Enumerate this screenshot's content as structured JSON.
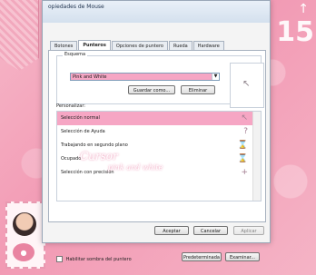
{
  "window": {
    "title": "opiedades de Mouse",
    "tabs": [
      {
        "label": "Botones"
      },
      {
        "label": "Punteros"
      },
      {
        "label": "Opciones de puntero"
      },
      {
        "label": "Rueda"
      },
      {
        "label": "Hardware"
      }
    ]
  },
  "scheme": {
    "group_label": "Esquema",
    "selected": "Pink and White",
    "save_as_label": "Guardar como...",
    "delete_label": "Eliminar"
  },
  "personalize": {
    "label": "Personalizar:",
    "items": [
      {
        "name": "Selección normal",
        "icon": "arrow-cursor"
      },
      {
        "name": "Selección de Ayuda",
        "icon": "help-cursor"
      },
      {
        "name": "Trabajando en segundo plano",
        "icon": "busy-cursor"
      },
      {
        "name": "Ocupado",
        "icon": "hourglass-cursor"
      },
      {
        "name": "Selección con precisión",
        "icon": "crosshair-cursor"
      }
    ]
  },
  "overlay": {
    "title": "Cursor",
    "subtitle": "pink and white"
  },
  "options": {
    "shadow_label": "Habilitar sombra del puntero",
    "default_label": "Predeterminada",
    "browse_label": "Examinar..."
  },
  "footer": {
    "ok_label": "Aceptar",
    "cancel_label": "Cancelar",
    "apply_label": "Aplicar"
  },
  "decor": {
    "number": "15",
    "arrow": "↑"
  },
  "colors": {
    "accent_pink": "#f6a6c4",
    "background_pink": "#f29ab4"
  }
}
